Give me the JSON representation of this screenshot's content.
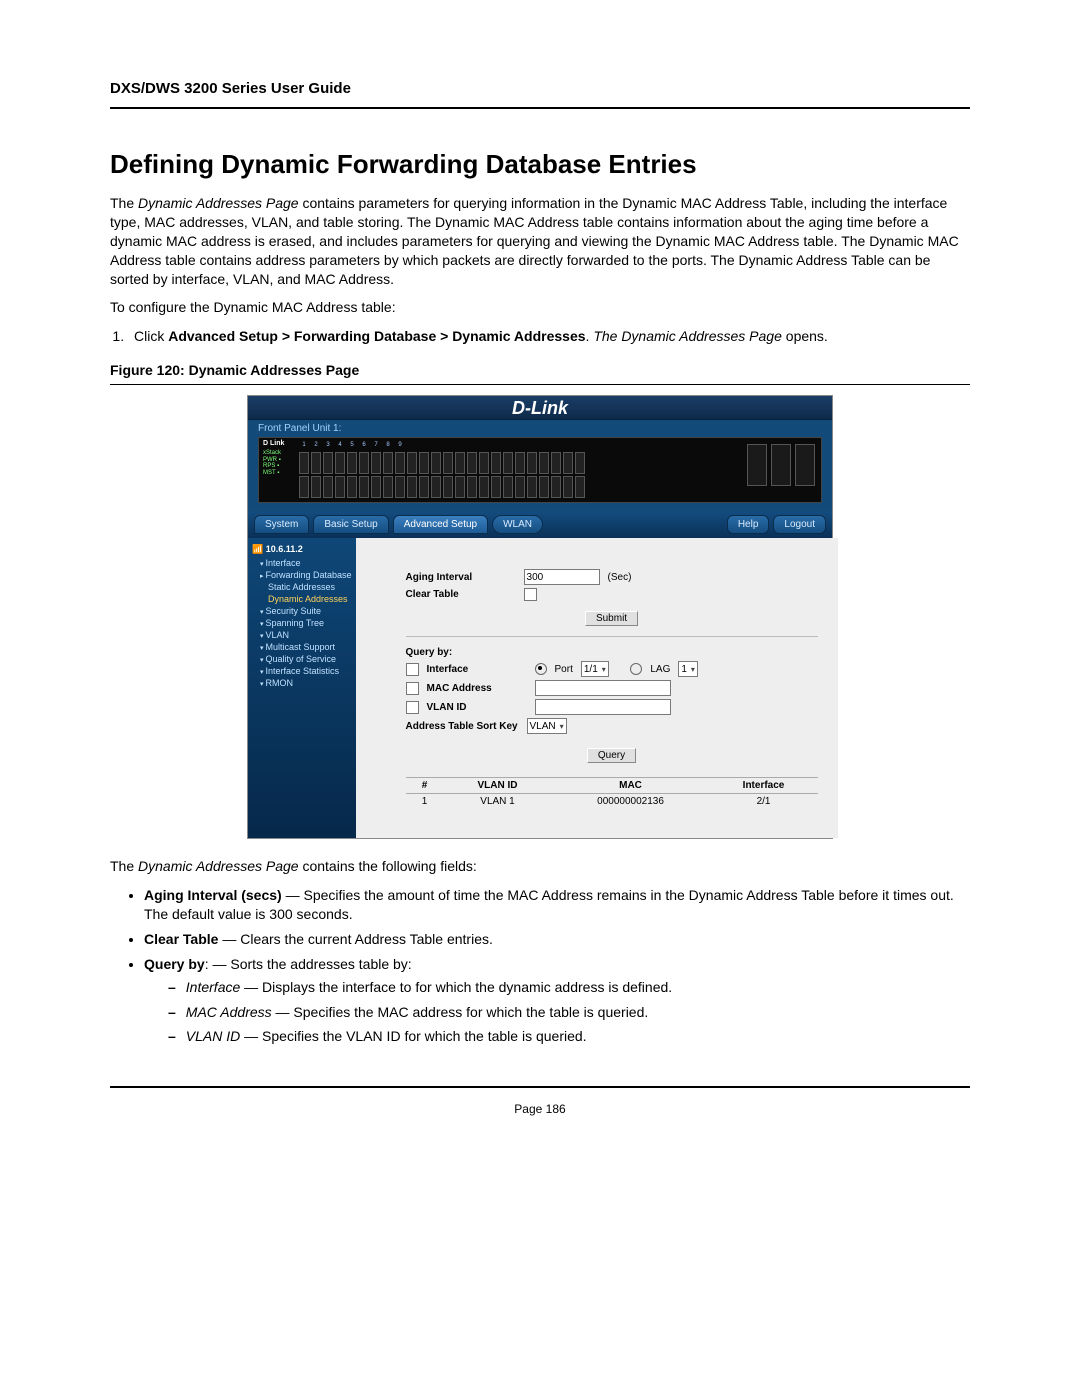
{
  "header": {
    "guide_title": "DXS/DWS 3200 Series User Guide"
  },
  "section": {
    "title": "Defining Dynamic Forwarding Database Entries",
    "intro_prefix": "The ",
    "intro_page_name": "Dynamic Addresses Page",
    "intro_rest": " contains parameters for querying information in the Dynamic MAC Address Table, including the interface type, MAC addresses, VLAN, and table storing. The Dynamic MAC Address table contains information about the aging time before a dynamic MAC address is erased, and includes parameters for querying and viewing the Dynamic MAC Address table. The Dynamic MAC Address table contains address parameters by which packets are directly forwarded to the ports. The Dynamic Address Table can be sorted by interface, VLAN, and MAC Address.",
    "config_line": "To configure the Dynamic MAC Address table:",
    "step1_pref": "Click ",
    "step1_bold": "Advanced Setup > Forwarding Database > Dynamic Addresses",
    "step1_mid": ". ",
    "step1_ital": "The Dynamic Addresses Page",
    "step1_end": " opens.",
    "fig_caption": "Figure 120: Dynamic Addresses Page"
  },
  "shot": {
    "brand": "D-Link",
    "fp_label": "Front Panel Unit 1:",
    "device_label": "D Link",
    "tabs": {
      "system": "System",
      "basic": "Basic Setup",
      "adv": "Advanced Setup",
      "wlan": "WLAN",
      "help": "Help",
      "logout": "Logout"
    },
    "sidebar": {
      "ip": "10.6.11.2",
      "items": [
        "Interface",
        "Forwarding Database",
        "Static Addresses",
        "Dynamic Addresses",
        "Security Suite",
        "Spanning Tree",
        "VLAN",
        "Multicast Support",
        "Quality of Service",
        "Interface Statistics",
        "RMON"
      ]
    },
    "form": {
      "aging_label": "Aging Interval",
      "aging_value": "300",
      "aging_unit": "(Sec)",
      "clear_label": "Clear Table",
      "submit": "Submit",
      "query_by": "Query by:",
      "interface": "Interface",
      "port": "Port",
      "port_val": "1/1",
      "lag": "LAG",
      "lag_val": "1",
      "mac": "MAC Address",
      "vlan": "VLAN ID",
      "sortkey": "Address Table Sort Key",
      "sort_val": "VLAN",
      "query": "Query"
    },
    "table": {
      "h1": "#",
      "h2": "VLAN ID",
      "h3": "MAC",
      "h4": "Interface",
      "r1": {
        "n": "1",
        "vlan": "VLAN 1",
        "mac": "000000002136",
        "if": "2/1"
      }
    }
  },
  "post": {
    "fields_intro_pref": "The ",
    "fields_intro_ital": "Dynamic Addresses Page",
    "fields_intro_rest": " contains the following fields:",
    "b1_bold": "Aging Interval (secs)",
    "b1_rest": " — Specifies the amount of time the MAC Address remains in the Dynamic Address Table before it times out. The default value is 300 seconds.",
    "b2_bold": "Clear Table",
    "b2_rest": " — Clears the current Address Table entries.",
    "b3_bold": "Query by",
    "b3_rest": ": — Sorts the addresses table by:",
    "d1_ital": "Interface",
    "d1_rest": " — Displays the interface to for which the dynamic address is defined.",
    "d2_ital": "MAC Address",
    "d2_rest": " — Specifies the MAC address for which the table is queried.",
    "d3_ital": "VLAN ID",
    "d3_rest": " — Specifies the VLAN ID for which the table is queried."
  },
  "footer": {
    "page": "Page 186"
  }
}
